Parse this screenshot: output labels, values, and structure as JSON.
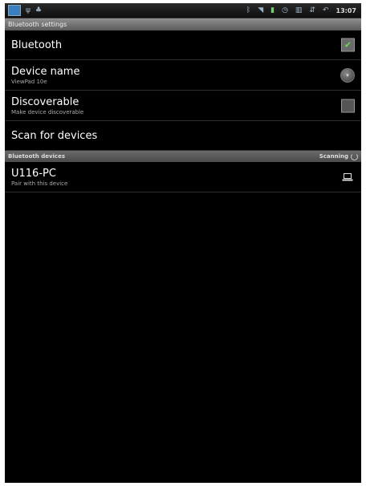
{
  "statusbar": {
    "left_icons": [
      "app-icon",
      "usb-icon",
      "android-icon"
    ],
    "right_icons": [
      "bluetooth-icon",
      "wifi-icon",
      "battery-icon",
      "clock-icon",
      "signal-icon",
      "sync-icon",
      "back-icon"
    ],
    "time": "13:07"
  },
  "title": "Bluetooth settings",
  "settings": {
    "bluetooth": {
      "label": "Bluetooth",
      "checked": true
    },
    "device_name": {
      "label": "Device name",
      "value": "ViewPad 10e"
    },
    "discoverable": {
      "label": "Discoverable",
      "summary": "Make device discoverable",
      "checked": false
    },
    "scan": {
      "label": "Scan for devices"
    }
  },
  "devices_section": {
    "header": "Bluetooth devices",
    "status": "Scanning"
  },
  "devices": [
    {
      "name": "U116-PC",
      "summary": "Pair with this device",
      "icon": "laptop-icon"
    }
  ]
}
